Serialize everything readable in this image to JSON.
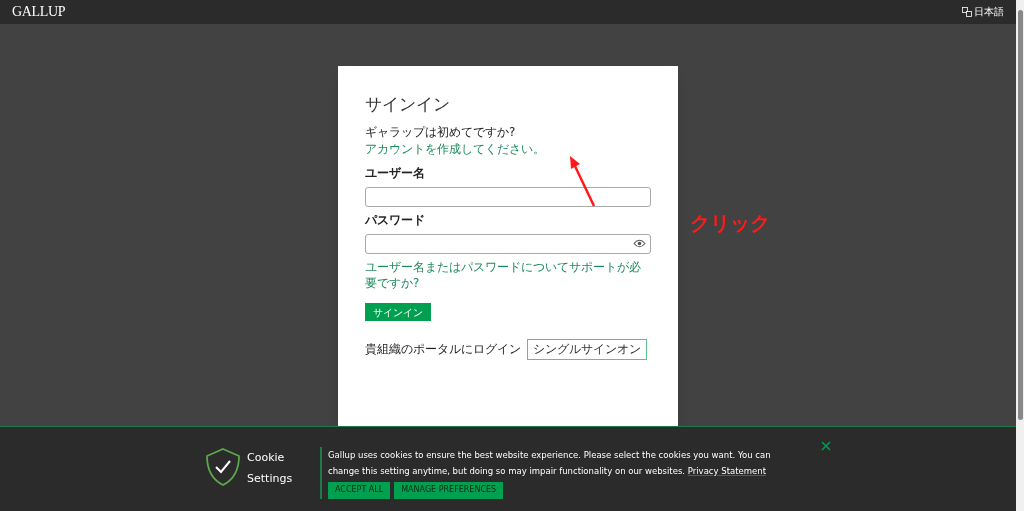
{
  "header": {
    "logo": "GALLUP",
    "language": "日本語"
  },
  "signin": {
    "title": "サインイン",
    "prompt": "ギャラップは初めてですか?",
    "create_link": "アカウントを作成してください。",
    "username_label": "ユーザー名",
    "password_label": "パスワード",
    "help_link": "ユーザー名またはパスワードについてサポートが必要ですか?",
    "submit": "サインイン",
    "org_label": "貴組織のポータルにログイン",
    "sso_button": "シングルサインオン"
  },
  "annotation": {
    "text": "クリック"
  },
  "cookie_banner": {
    "title_lines": [
      "Cookie",
      "Settings"
    ],
    "message": "Gallup uses cookies to ensure the best website experience. Please select the cookies you want. You can change this setting anytime, but doing so may impair functionality on our websites.",
    "link": "Privacy Statement",
    "buttons": [
      "ACCEPT ALL",
      "MANAGE PREFERENCES"
    ]
  }
}
